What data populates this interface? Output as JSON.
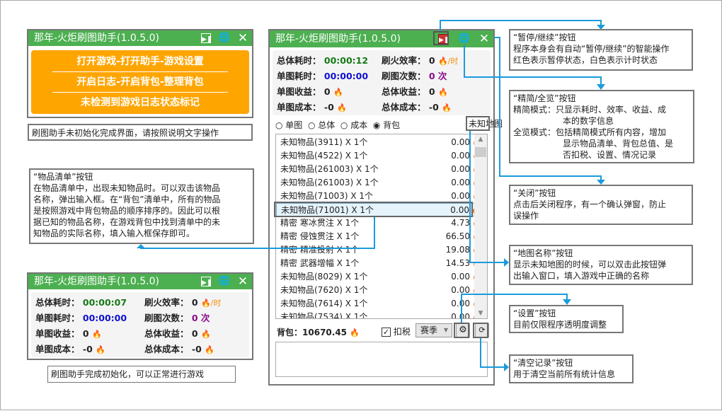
{
  "app_title": "那年-火炬刷图助手(1.0.5.0)",
  "title_buttons": {
    "pause": "▶❚",
    "globe": "🌐",
    "close": "✕"
  },
  "init_panel": {
    "lines": [
      "打开游戏-打开助手-游戏设置",
      "开启日志-开启背包-整理背包",
      "未检测到游戏日志状态标记"
    ],
    "caption": "刷图助手未初始化完成界面，请按照说明文字操作"
  },
  "stats_labels": {
    "total_time": "总体耗时：",
    "map_time": "单图耗时：",
    "map_income": "单图收益：",
    "map_cost": "单图成本：",
    "rate": "刷火效率：",
    "runs": "刷图次数：",
    "total_income": "总体收益：",
    "total_cost": "总体成本："
  },
  "main_stats": {
    "total_time": "00:00:12",
    "map_time": "00:00:00",
    "map_income": "0",
    "map_cost": "-0",
    "rate": "0",
    "rate_unit": "/时",
    "runs": "0 次",
    "total_income": "0",
    "total_cost": "-0"
  },
  "ready_stats": {
    "total_time": "00:00:07",
    "map_time": "00:00:00",
    "map_income": "0",
    "map_cost": "-0",
    "rate": "0",
    "rate_unit": "/时",
    "runs": "0 次",
    "total_income": "0",
    "total_cost": "-0",
    "caption": "刷图助手完成初始化，可以正常进行游戏"
  },
  "radios": [
    "单图",
    "总体",
    "成本",
    "背包"
  ],
  "selected_radio": "背包",
  "map_button": "未知地图",
  "items": [
    {
      "name": "未知物品(3911) X 1个",
      "value": "0.00"
    },
    {
      "name": "未知物品(4522) X 1个",
      "value": "0.00"
    },
    {
      "name": "未知物品(261003) X 1个",
      "value": "0.00"
    },
    {
      "name": "未知物品(261003) X 1个",
      "value": "0.00"
    },
    {
      "name": "未知物品(71003) X 1个",
      "value": "0.00"
    },
    {
      "name": "未知物品(71001) X 1个",
      "value": "0.00"
    },
    {
      "name": "精密 寒冰贯注 X 1个",
      "value": "4.73"
    },
    {
      "name": "精密 侵蚀贯注 X 1个",
      "value": "66.50"
    },
    {
      "name": "精密 精准投射 X 1个",
      "value": "19.08"
    },
    {
      "name": "精密 武器增幅 X 1个",
      "value": "14.53"
    },
    {
      "name": "未知物品(8029) X 1个",
      "value": "0.00"
    },
    {
      "name": "未知物品(7620) X 1个",
      "value": "0.00"
    },
    {
      "name": "未知物品(7614) X 1个",
      "value": "0.00"
    },
    {
      "name": "未知物品(7534) X 1个",
      "value": "0.00"
    }
  ],
  "bag_label": "背包：",
  "bag_value": "10670.45",
  "tax_label": "扣税",
  "tax_checked": true,
  "season_select": "赛季",
  "flame_icon": "🔥",
  "notes": {
    "item_list": [
      "“物品清单”按钮",
      "在物品清单中，出现未知物品时。可以双击该物品",
      "名称，弹出输入框。在“背包”清单中，所有的物品",
      "是按照游戏中背包物品的顺序排序的。因此可以根",
      "据已知的物品名称，在游戏背包中找到清单中的未",
      "知物品的实际名称，填入输入框保存即可。"
    ],
    "pause": [
      "“暂停/继续”按钮",
      "程序本身会有自动“暂停/继续”的智能操作",
      "红色表示暂停状态，白色表示计时状态"
    ],
    "mode": [
      "“精简/全览”按钮",
      "精简模式：只显示耗时、效率、收益、成",
      "本的数字信息",
      "全览模式：包括精简模式所有内容，增加",
      "显示物品清单、背包总值、是",
      "否扣税、设置、情况记录"
    ],
    "close": [
      "“关闭”按钮",
      "点击后关闭程序，有一个确认弹窗，防止",
      "误操作"
    ],
    "map": [
      "“地图名称”按钮",
      "显示未知地图的时候，可以双击此按钮弹",
      "出输入窗口，填入游戏中正确的名称"
    ],
    "settings": [
      "“设置”按钮",
      "目前仅限程序透明度调整"
    ],
    "clear": [
      "“清空记录”按钮",
      "用于清空当前所有统计信息"
    ]
  },
  "colors": {
    "title_green": "#4caf50",
    "orange": "#ffa500",
    "connector": "#1a9bdc",
    "pause_red": "#d32f2f"
  }
}
